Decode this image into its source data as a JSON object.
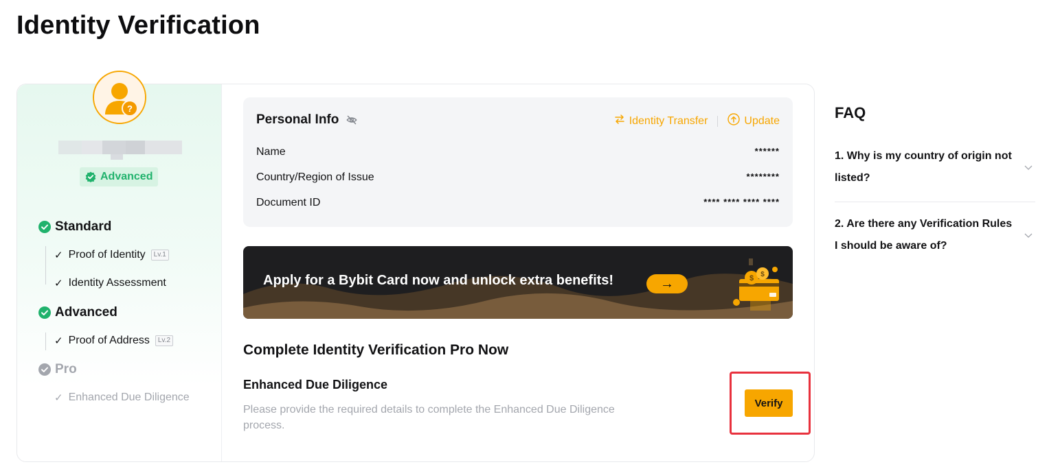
{
  "page": {
    "title": "Identity Verification"
  },
  "sidebar": {
    "badge": "Advanced",
    "levels": [
      {
        "name": "Standard",
        "status": "completed",
        "items": [
          {
            "label": "Proof of Identity",
            "tag": "Lv.1"
          },
          {
            "label": "Identity Assessment",
            "tag": ""
          }
        ]
      },
      {
        "name": "Advanced",
        "status": "completed",
        "items": [
          {
            "label": "Proof of Address",
            "tag": "Lv.2"
          }
        ]
      },
      {
        "name": "Pro",
        "status": "pending",
        "items": [
          {
            "label": "Enhanced Due Diligence",
            "tag": ""
          }
        ]
      }
    ]
  },
  "personal_info": {
    "title": "Personal Info",
    "identity_transfer": "Identity Transfer",
    "update": "Update",
    "rows": [
      {
        "label": "Name",
        "value": "******"
      },
      {
        "label": "Country/Region of Issue",
        "value": "********"
      },
      {
        "label": "Document ID",
        "value": "**** **** **** ****"
      }
    ]
  },
  "banner": {
    "text": "Apply for a Bybit Card now and unlock extra benefits!",
    "arrow": "→"
  },
  "pro": {
    "section_title": "Complete Identity Verification Pro Now",
    "edd_title": "Enhanced Due Diligence",
    "edd_desc": "Please provide the required details to complete the Enhanced Due Diligence process.",
    "verify_label": "Verify"
  },
  "faq": {
    "title": "FAQ",
    "items": [
      {
        "q": "1. Why is my country of origin not listed?"
      },
      {
        "q": "2. Are there any Verification Rules I should be aware of?"
      }
    ]
  },
  "colors": {
    "accent": "#f7a600",
    "success": "#20b26c",
    "highlight": "#e8313d"
  },
  "icons": [
    "user-avatar-icon",
    "shield-check-icon",
    "check-circle-icon",
    "check-icon",
    "eye-off-icon",
    "transfer-icon",
    "upload-circle-icon",
    "arrow-right-icon",
    "chevron-down-icon"
  ]
}
